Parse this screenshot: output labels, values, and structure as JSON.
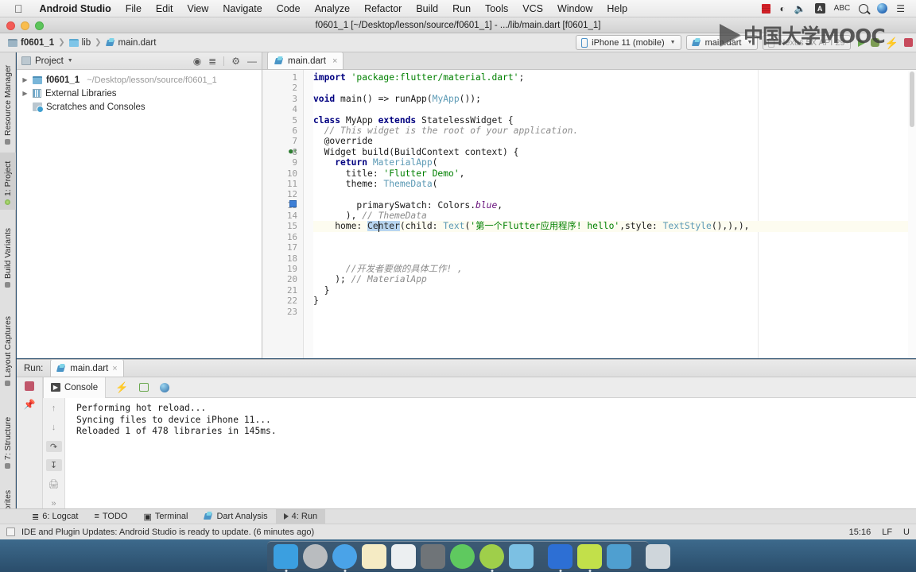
{
  "macmenu": {
    "apple_icon": "apple-icon",
    "items": [
      "Android Studio",
      "File",
      "Edit",
      "View",
      "Navigate",
      "Code",
      "Analyze",
      "Refactor",
      "Build",
      "Run",
      "Tools",
      "VCS",
      "Window",
      "Help"
    ],
    "status_icons": [
      "battery-icon",
      "wifi-icon",
      "volume-icon",
      "input-source-icon",
      "abc-label",
      "spotlight-search-icon",
      "siri-icon",
      "control-center-icon"
    ],
    "abc_label": "A",
    "abc_text": "ABC"
  },
  "titlebar": {
    "title": "f0601_1 [~/Desktop/lesson/source/f0601_1] - .../lib/main.dart [f0601_1]"
  },
  "navbar": {
    "breadcrumbs": [
      {
        "label": "f0601_1",
        "icon": "module-icon",
        "bold": true
      },
      {
        "label": "lib",
        "icon": "folder-icon",
        "bold": false
      },
      {
        "label": "main.dart",
        "icon": "dart-file-icon",
        "bold": false
      }
    ],
    "device_selector": "iPhone 11 (mobile)",
    "config_selector": "main.dart",
    "secondary_device": "Nexus 5X API 29",
    "run_icons": [
      "run-icon",
      "debug-icon",
      "hot-reload-icon",
      "stop-icon"
    ]
  },
  "leftstrip": {
    "items": [
      {
        "label": "Resource Manager",
        "active": false
      },
      {
        "label": "1: Project",
        "active": true
      },
      {
        "label": "Build Variants",
        "active": false
      },
      {
        "label": "Layout Captures",
        "active": false
      },
      {
        "label": "7: Structure",
        "active": false
      },
      {
        "label": "Favorites",
        "active": false
      }
    ]
  },
  "project_panel": {
    "title": "Project",
    "header_icons": [
      "target-icon",
      "collapse-all-icon",
      "settings-gear-icon",
      "minimize-icon"
    ],
    "tree": [
      {
        "label": "f0601_1",
        "path": "~/Desktop/lesson/source/f0601_1",
        "icon": "module-icon",
        "arrow": "▶",
        "bold": true
      },
      {
        "label": "External Libraries",
        "path": "",
        "icon": "library-icon",
        "arrow": "▶",
        "bold": false
      },
      {
        "label": "Scratches and Consoles",
        "path": "",
        "icon": "scratch-icon",
        "arrow": "",
        "bold": false
      }
    ]
  },
  "editor": {
    "tab_label": "main.dart",
    "tab_close": "×",
    "total_lines": 23,
    "lines": [
      {
        "n": 1,
        "tokens": [
          {
            "t": "import",
            "c": "kw"
          },
          {
            "t": " ",
            "c": "pln"
          },
          {
            "t": "'package:flutter/material.dart'",
            "c": "str"
          },
          {
            "t": ";",
            "c": "pln"
          }
        ]
      },
      {
        "n": 2,
        "tokens": []
      },
      {
        "n": 3,
        "tokens": [
          {
            "t": "void",
            "c": "kw"
          },
          {
            "t": " main() => runApp(",
            "c": "pln"
          },
          {
            "t": "MyApp",
            "c": "cls"
          },
          {
            "t": "());",
            "c": "pln"
          }
        ]
      },
      {
        "n": 4,
        "tokens": []
      },
      {
        "n": 5,
        "tokens": [
          {
            "t": "class",
            "c": "kw"
          },
          {
            "t": " MyApp ",
            "c": "pln"
          },
          {
            "t": "extends",
            "c": "kw"
          },
          {
            "t": " StatelessWidget {",
            "c": "pln"
          }
        ]
      },
      {
        "n": 6,
        "tokens": [
          {
            "t": "  // This widget is the root of your application.",
            "c": "cmt"
          }
        ]
      },
      {
        "n": 7,
        "tokens": [
          {
            "t": "  @override",
            "c": "pln"
          }
        ]
      },
      {
        "n": 8,
        "tokens": [
          {
            "t": "  Widget build(BuildContext context) {",
            "c": "pln"
          }
        ]
      },
      {
        "n": 9,
        "tokens": [
          {
            "t": "    ",
            "c": "pln"
          },
          {
            "t": "return",
            "c": "kw"
          },
          {
            "t": " ",
            "c": "pln"
          },
          {
            "t": "MaterialApp",
            "c": "cls"
          },
          {
            "t": "(",
            "c": "pln"
          }
        ]
      },
      {
        "n": 10,
        "tokens": [
          {
            "t": "      title: ",
            "c": "pln"
          },
          {
            "t": "'Flutter Demo'",
            "c": "str"
          },
          {
            "t": ",",
            "c": "pln"
          }
        ]
      },
      {
        "n": 11,
        "tokens": [
          {
            "t": "      theme: ",
            "c": "pln"
          },
          {
            "t": "ThemeData",
            "c": "cls"
          },
          {
            "t": "(",
            "c": "pln"
          }
        ]
      },
      {
        "n": 12,
        "tokens": []
      },
      {
        "n": 13,
        "tokens": [
          {
            "t": "        primarySwatch: Colors.",
            "c": "pln"
          },
          {
            "t": "blue",
            "c": "fld"
          },
          {
            "t": ",",
            "c": "pln"
          }
        ]
      },
      {
        "n": 14,
        "tokens": [
          {
            "t": "      ), ",
            "c": "pln"
          },
          {
            "t": "// ThemeData",
            "c": "cmt"
          }
        ]
      },
      {
        "n": 15,
        "tokens": [
          {
            "t": "    home: ",
            "c": "pln"
          },
          {
            "t": "Center",
            "c": "sel"
          },
          {
            "t": "(child: ",
            "c": "pln"
          },
          {
            "t": "Text",
            "c": "cls"
          },
          {
            "t": "(",
            "c": "pln"
          },
          {
            "t": "'第一个Flutter应用程序! hello'",
            "c": "str"
          },
          {
            "t": ",style: ",
            "c": "pln"
          },
          {
            "t": "TextStyle",
            "c": "cls"
          },
          {
            "t": "(),),),",
            "c": "pln"
          }
        ]
      },
      {
        "n": 16,
        "tokens": []
      },
      {
        "n": 17,
        "tokens": []
      },
      {
        "n": 18,
        "tokens": []
      },
      {
        "n": 19,
        "tokens": [
          {
            "t": "      //开发者要做的具体工作! ,",
            "c": "cmt"
          }
        ]
      },
      {
        "n": 20,
        "tokens": [
          {
            "t": "    ); ",
            "c": "pln"
          },
          {
            "t": "// MaterialApp",
            "c": "cmt"
          }
        ]
      },
      {
        "n": 21,
        "tokens": [
          {
            "t": "  }",
            "c": "pln"
          }
        ]
      },
      {
        "n": 22,
        "tokens": [
          {
            "t": "}",
            "c": "pln"
          }
        ]
      },
      {
        "n": 23,
        "tokens": []
      }
    ],
    "highlight_line": 15,
    "bookmark_line": 13,
    "override_marker_line": 8
  },
  "run_panel": {
    "label": "Run:",
    "tab": "main.dart",
    "tab_close": "×",
    "console_tab": "Console",
    "console_icons": [
      "hot-reload-icon",
      "hot-restart-icon",
      "open-observatory-icon"
    ],
    "side_icons": [
      "scroll-up-icon",
      "scroll-down-icon",
      "soft-wrap-icon",
      "scroll-to-end-icon",
      "print-icon",
      "expand-icon"
    ],
    "output": [
      "Performing hot reload...",
      "Syncing files to device iPhone 11...",
      "Reloaded 1 of 478 libraries in 145ms."
    ]
  },
  "toolwindow_bar": {
    "items": [
      {
        "label": "6: Logcat",
        "underline": "6",
        "icon": "logcat-icon",
        "active": false
      },
      {
        "label": "TODO",
        "underline": "",
        "icon": "todo-icon",
        "active": false
      },
      {
        "label": "Terminal",
        "underline": "",
        "icon": "terminal-icon",
        "active": false
      },
      {
        "label": "Dart Analysis",
        "underline": "",
        "icon": "dart-analysis-icon",
        "active": false
      },
      {
        "label": "4: Run",
        "underline": "4",
        "icon": "run-icon",
        "active": true
      }
    ]
  },
  "statusbar": {
    "message": "IDE and Plugin Updates: Android Studio is ready to update. (6 minutes ago)",
    "time": "15:16",
    "line_separator": "LF",
    "encoding": "U"
  },
  "watermark": {
    "text": "中国大学MOOC",
    "icon": "play-logo-icon"
  },
  "dock": {
    "items": [
      {
        "name": "finder",
        "color": "#3b9fe0"
      },
      {
        "name": "launchpad",
        "color": "#b9bcbf"
      },
      {
        "name": "safari",
        "color": "#4aa3e8"
      },
      {
        "name": "notes",
        "color": "#f5ebc4"
      },
      {
        "name": "photos",
        "color": "#eceff1"
      },
      {
        "name": "system-preferences",
        "color": "#6f7478"
      },
      {
        "name": "wechat",
        "color": "#5fc95f"
      },
      {
        "name": "android-studio",
        "color": "#9fcf4a"
      },
      {
        "name": "folder",
        "color": "#7cc0e3"
      },
      {
        "name": "wps",
        "color": "#2d6fd4"
      },
      {
        "name": "notability",
        "color": "#c2e04a"
      },
      {
        "name": "files",
        "color": "#4f9fd0"
      },
      {
        "name": "trash",
        "color": "#cfd6db"
      }
    ]
  }
}
